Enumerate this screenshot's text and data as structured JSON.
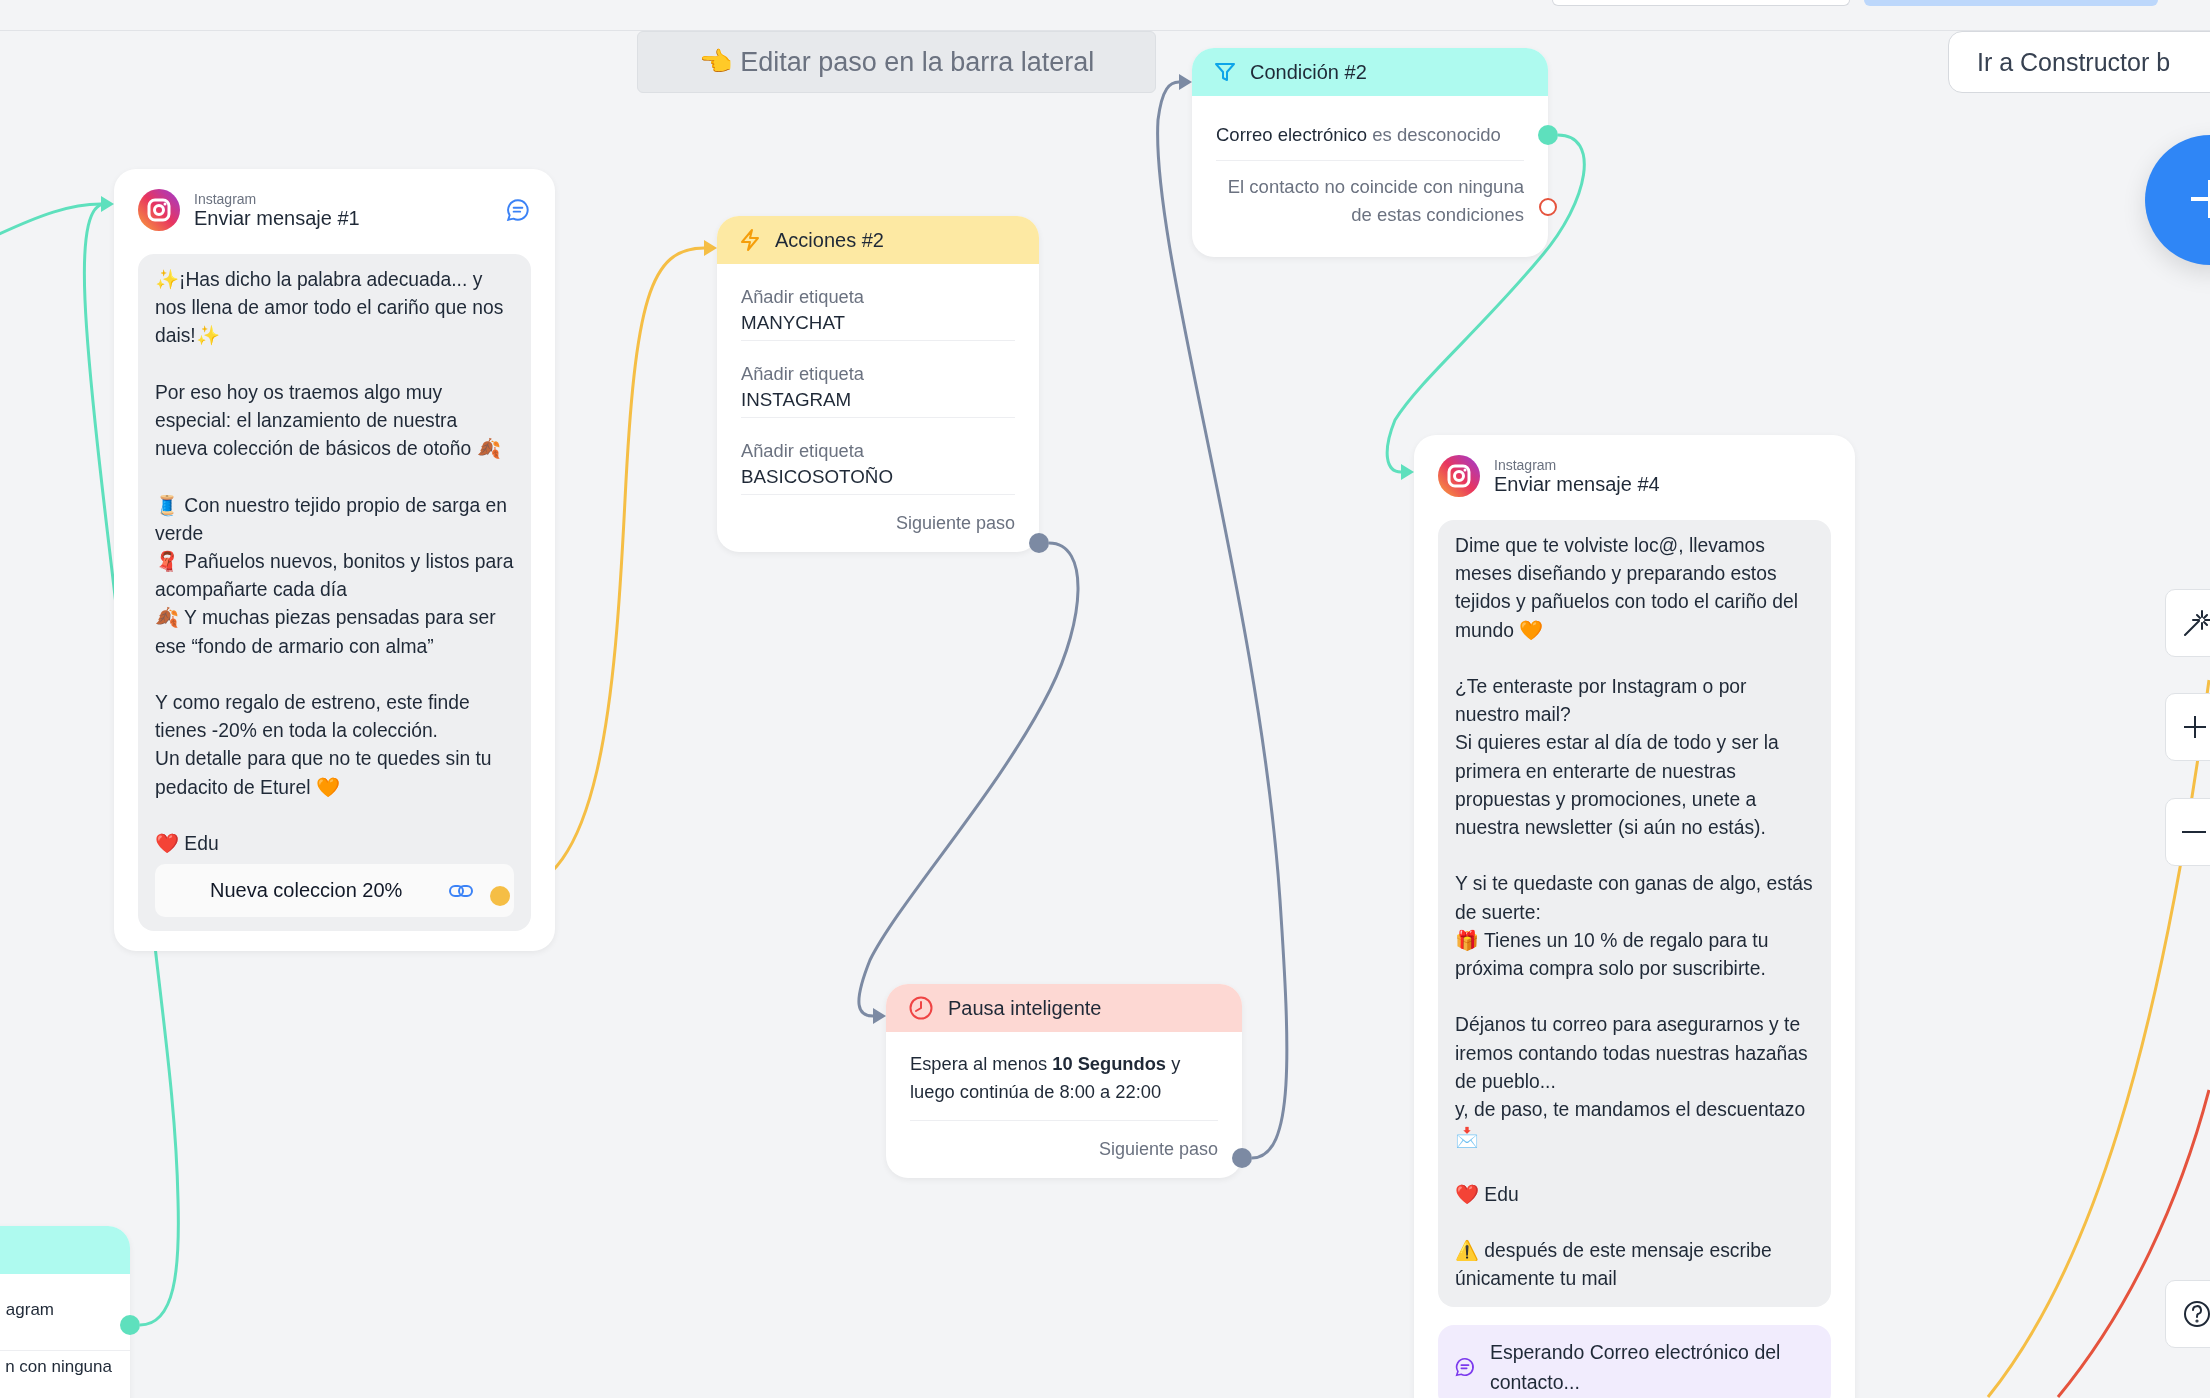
{
  "edit_hint": "👈 Editar paso en la barra lateral",
  "builder_button": "Ir a Constructor b",
  "nodes": [
    {
      "kind": "message",
      "channel": "Instagram",
      "title": "Enviar mensaje #1",
      "comment_icon": true,
      "text": "✨¡Has dicho la palabra adecuada... y nos llena de amor todo el cariño que nos dais!✨\n\nPor eso hoy os traemos algo muy especial: el lanzamiento de nuestra nueva colección de básicos de otoño 🍂\n\n🧵 Con nuestro tejido propio de sarga en verde\n🧣 Pañuelos nuevos, bonitos y listos para acompañarte cada día\n🍂 Y muchas piezas pensadas para ser ese “fondo de armario con alma”\n\nY como regalo de estreno, este finde tienes -20% en toda la colección.\nUn detalle para que no te quedes sin tu pedacito de Eturel 🧡\n\n❤️ Edu",
      "buttons": [
        {
          "label": "Nueva coleccion 20%"
        }
      ]
    },
    {
      "kind": "actions",
      "title": "Acciones #2",
      "items": [
        {
          "label": "Añadir etiqueta",
          "value": "MANYCHAT"
        },
        {
          "label": "Añadir etiqueta",
          "value": "INSTAGRAM"
        },
        {
          "label": "Añadir etiqueta",
          "value": "BASICOSOTOÑO"
        }
      ],
      "next": "Siguiente paso"
    },
    {
      "kind": "condition",
      "title": "Condición #2",
      "conditions": [
        {
          "field": "Correo electrónico",
          "operator": "es desconocido"
        }
      ],
      "fallback": "El contacto no coincide con ninguna de estas condiciones"
    },
    {
      "kind": "pause",
      "title": "Pausa inteligente",
      "text": "Espera al menos **10 Segundos** y luego continúa de 8:00 a 22:00",
      "next": "Siguiente paso"
    },
    {
      "kind": "message",
      "channel": "Instagram",
      "title": "Enviar mensaje #4",
      "text": "Dime que te volviste loc@, llevamos meses diseñando y preparando estos tejidos y pañuelos con todo el cariño del mundo 🧡\n\n¿Te enteraste por Instagram o por nuestro mail?\nSi quieres estar al día de todo y ser la primera en enterarte de nuestras propuestas y promociones, unete a nuestra newsletter (si aún no estás).\n\nY si te quedaste con ganas de algo, estás de suerte:\n🎁 Tienes un 10 % de regalo para tu próxima compra solo por suscribirte.\n\nDéjanos tu correo para asegurarnos y te iremos contando todas nuestras hazañas de pueblo...\ny, de paso, te mandamos el descuentazo 📩\n\n❤️ Edu\n\n⚠️ después de este mensaje escribe únicamente tu mail",
      "waiting": "Esperando Correo electrónico del contacto..."
    },
    {
      "kind": "condition-partial",
      "lines": [
        "agram",
        "n con ninguna"
      ]
    }
  ]
}
